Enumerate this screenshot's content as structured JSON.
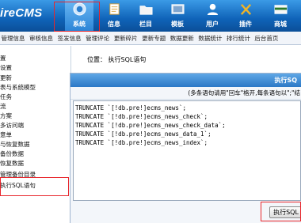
{
  "header": {
    "logo": "ireCMS",
    "nav": [
      {
        "label": "系统",
        "icon": "system-icon"
      },
      {
        "label": "信息",
        "icon": "info-icon"
      },
      {
        "label": "栏目",
        "icon": "column-icon"
      },
      {
        "label": "模板",
        "icon": "template-icon"
      },
      {
        "label": "用户",
        "icon": "user-icon"
      },
      {
        "label": "插件",
        "icon": "plugin-icon"
      },
      {
        "label": "商城",
        "icon": "shop-icon"
      }
    ]
  },
  "subnav": [
    "管理信息",
    "审核信息",
    "签发信息",
    "管理评论",
    "更新碎片",
    "更新专题",
    "数据更新",
    "数据统计",
    "排行统计",
    "后台首页"
  ],
  "sidebar": {
    "items": [
      "置",
      "设置",
      "更新",
      "表与系统模型",
      "任务",
      "流",
      "方案",
      "多访问端",
      "意单",
      "与恢复数据",
      "备份数据",
      "恢复数据",
      "管理备份目录",
      "执行SQL语句"
    ]
  },
  "main": {
    "location_label": "位置：",
    "location_value": "执行SQL语句",
    "panel_title": "执行SQ",
    "panel_note": "(多条语句请用\"回车\"格开,每条语句以\";\"结",
    "sql_lines": [
      "TRUNCATE `[!db.pre!]ecms_news`;",
      "TRUNCATE `[!db.pre!]ecms_news_check`;",
      "TRUNCATE `[!db.pre!]ecms_news_check_data`;",
      "TRUNCATE `[!db.pre!]ecms_news_data_1`;",
      "TRUNCATE `[!db.pre!]ecms_news_index`;"
    ],
    "execute_button": "执行SQL"
  }
}
